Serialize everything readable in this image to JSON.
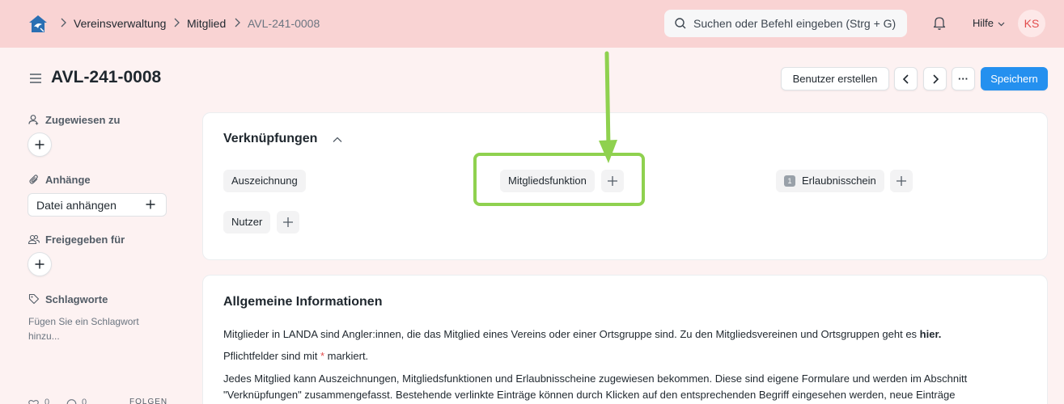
{
  "navbar": {
    "breadcrumbs": [
      "Vereinsverwaltung",
      "Mitglied",
      "AVL-241-0008"
    ],
    "search_placeholder": "Suchen oder Befehl eingeben (Strg + G)",
    "help_label": "Hilfe",
    "avatar_initials": "KS"
  },
  "page": {
    "title": "AVL-241-0008",
    "create_user_label": "Benutzer erstellen",
    "more_label": "···",
    "save_label": "Speichern"
  },
  "sidebar": {
    "assigned_label": "Zugewiesen zu",
    "attachments_label": "Anhänge",
    "attach_file_label": "Datei anhängen",
    "shared_label": "Freigegeben für",
    "tags_label": "Schlagworte",
    "tags_hint": "Fügen Sie ein Schlagwort hinzu...",
    "likes_count": "0",
    "comments_count": "0",
    "follow_label": "FOLGEN"
  },
  "connections": {
    "title": "Verknüpfungen",
    "items": [
      {
        "label": "Auszeichnung"
      },
      {
        "label": "Mitgliedsfunktion"
      },
      {
        "label": "Erlaubnisschein",
        "count": "1"
      },
      {
        "label": "Nutzer"
      }
    ]
  },
  "general": {
    "title": "Allgemeine Informationen",
    "para1_text": "Mitglieder in LANDA sind Angler:innen, die das Mitglied eines Vereins oder einer Ortsgruppe sind. Zu den Mitgliedsvereinen und Ortsgruppen geht es ",
    "para1_link": "hier.",
    "para2_before": "Pflichtfelder sind mit ",
    "para2_star": "*",
    "para2_after": " markiert.",
    "para3_text": "Jedes Mitglied kann Auszeichnungen, Mitgliedsfunktionen und Erlaubnisscheine zugewiesen bekommen. Diese sind eigene Formulare und werden im Abschnitt \"Verknüpfungen\" zusammengefasst. Bestehende verlinkte Einträge können durch Klicken auf den entsprechenden Begriff eingesehen werden, neue Einträge"
  },
  "colors": {
    "navbar_bg": "#f9d3d3",
    "page_bg": "#fdf2f2",
    "primary": "#2490ef",
    "highlight": "#8fd14f",
    "avatar_text": "#e24c4c"
  }
}
